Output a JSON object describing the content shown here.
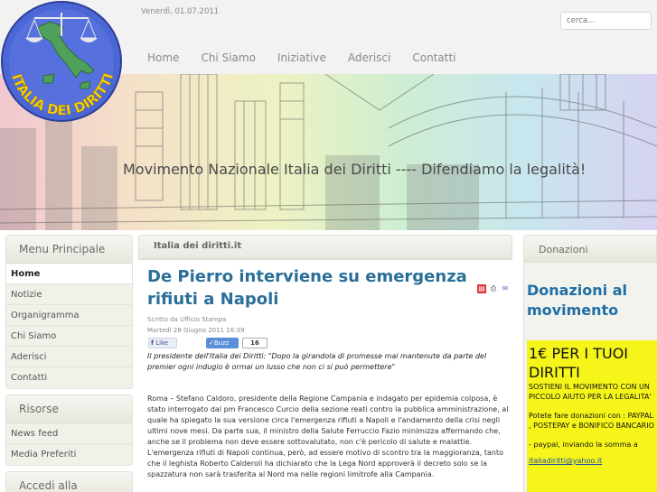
{
  "header": {
    "date": "Venerdì, 01.07.2011",
    "search_placeholder": "cerca...",
    "nav": [
      "Home",
      "Chi Siamo",
      "Iniziative",
      "Aderisci",
      "Contatti"
    ]
  },
  "logo": {
    "text_arc": "ITALIA DEI DIRITTI",
    "icon": "italy-scales-logo"
  },
  "banner": {
    "slogan": "Movimento Nazionale Italia dei Diritti ---- Difendiamo la legalità!"
  },
  "sidebar": {
    "main_menu_title": "Menu Principale",
    "main_menu": [
      "Home",
      "Notizie",
      "Organigramma",
      "Chi Siamo",
      "Aderisci",
      "Contatti"
    ],
    "resources_title": "Risorse",
    "resources": [
      "News feed",
      "Media Preferiti"
    ],
    "community_title": "Accedi alla community"
  },
  "content": {
    "breadcrumb": "Italia dei diritti.it",
    "article_title": "De Pierro interviene su emergenza rifiuti a Napoli",
    "author": "Scritto da Ufficio Stampa",
    "date": "Martedì 28 Giugno 2011 16:39",
    "fb_like": "Like",
    "buzz": "Buzz",
    "buzz_count": "16",
    "intro": "Il presidente dell'Italia dei Diritti: \"Dopo la girandola di promesse mai mantenute da parte del premier ogni indugio è ormai un lusso che non ci si può permettere\"",
    "body": "Roma – Stefano Caldoro, presidente della Regione Campania e indagato per epidemia colposa, è stato interrogato dal pm Francesco Curcio della sezione reati contro la pubblica amministrazione, al quale ha spiegato la sua versione circa l'emergenza rifiuti a Napoli e l'andamento della crisi negli ultimi nove mesi. Da parte sua, il ministro della Salute Ferruccio Fazio minimizza affermando che, anche se il problema non deve essere sottovalutato, non c'è pericolo di salute e malattie. L'emergenza rifiuti di Napoli continua, però, ad essere motivo di scontro tra la maggioranza, tanto che il leghista Roberto Calderoli ha dichiarato che la Lega Nord approverà il decreto solo se la spazzatura non sarà trasferita al Nord ma nelle regioni limitrofe alla Campania."
  },
  "right": {
    "title": "Donazioni",
    "heading": "Donazioni al movimento",
    "yellow_big": "1€ PER I TUOI DIRITTI",
    "yellow_p1": "SOSTIENI IL MOVIMENTO CON UN PICCOLO AIUTO PER LA LEGALITA'",
    "yellow_p2": "Potete fare donazioni con : PAYPAL , POSTEPAY e BONIFICO BANCARIO",
    "yellow_p3": "- paypal, inviando la somma a",
    "yellow_link": "italiadiritti@yahoo.it"
  },
  "colors": {
    "title_blue": "#2a6f99",
    "donation_yellow": "#f6f51a",
    "donation_blue": "#1f6ea5"
  }
}
